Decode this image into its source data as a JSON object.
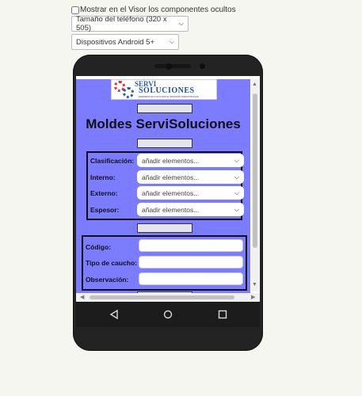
{
  "viewer": {
    "show_hidden_label": "Mostrar en el Visor los componentes ocultos",
    "phone_size": "Tamaño del teléfono (320 x 505)",
    "device": "Dispositivos Android 5+"
  },
  "app": {
    "logo": {
      "line1": "SERVI",
      "line2": "SOLUCIONES",
      "tagline": "EMPRESA EN CAUCHOS E INSUMOS INDUSTRIALES"
    },
    "title": "Moldes ServiSoluciones",
    "select_fields": [
      {
        "label": "Clasificación:",
        "value": "añadir elementos..."
      },
      {
        "label": "Interno:",
        "value": "añadir elementos..."
      },
      {
        "label": "Externo:",
        "value": "añadir elementos..."
      },
      {
        "label": "Espesor:",
        "value": "añadir elementos..."
      }
    ],
    "text_fields": [
      {
        "label": "Código:",
        "value": ""
      },
      {
        "label": "Tipo de caucho:",
        "value": ""
      },
      {
        "label": "Observación:",
        "value": ""
      }
    ]
  },
  "colors": {
    "app_background": "#7b7cff",
    "phone_body": "#232323"
  },
  "icons": [
    "chevron-down-icon",
    "back-icon",
    "home-icon",
    "recents-icon",
    "gear-icon"
  ]
}
